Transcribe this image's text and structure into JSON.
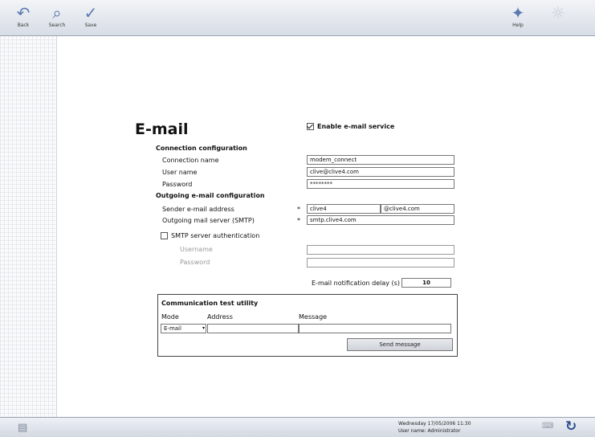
{
  "toolbar": {
    "left_buttons": [
      {
        "label": "Back",
        "icon": "back-arrow-icon"
      },
      {
        "label": "Search",
        "icon": "search-icon"
      },
      {
        "label": "Save",
        "icon": "checkmark-icon"
      }
    ],
    "right_buttons": [
      {
        "label": "Help",
        "icon": "wand-icon"
      },
      {
        "label": "",
        "icon": "light-icon"
      }
    ]
  },
  "email": {
    "title": "E-mail",
    "enable_label": "Enable e-mail service",
    "enable_checked": true,
    "connection_section": "Connection configuration",
    "connection_name_label": "Connection name",
    "connection_name_value": "modem_connect",
    "user_name_label": "User name",
    "user_name_value": "clive@clive4.com",
    "password_label": "Password",
    "password_value": "********",
    "outgoing_section": "Outgoing e-mail configuration",
    "sender_label": "Sender e-mail address",
    "sender_user": "clive4",
    "sender_domain": "@clive4.com",
    "smtp_label": "Outgoing mail server (SMTP)",
    "smtp_value": "smtp.clive4.com",
    "smtp_auth_label": "SMTP server authentication",
    "smtp_auth_checked": false,
    "auth_username_label": "Username",
    "auth_password_label": "Password",
    "delay_label": "E-mail notification delay (s)",
    "delay_value": "10",
    "required_mark": "*"
  },
  "test_utility": {
    "title": "Communication test utility",
    "mode_label": "Mode",
    "address_label": "Address",
    "message_label": "Message",
    "mode_value": "E-mail",
    "send_label": "Send message"
  },
  "status": {
    "datetime": "Wednesday  17/05/2006   11:30",
    "user": "User name: Administrator"
  }
}
